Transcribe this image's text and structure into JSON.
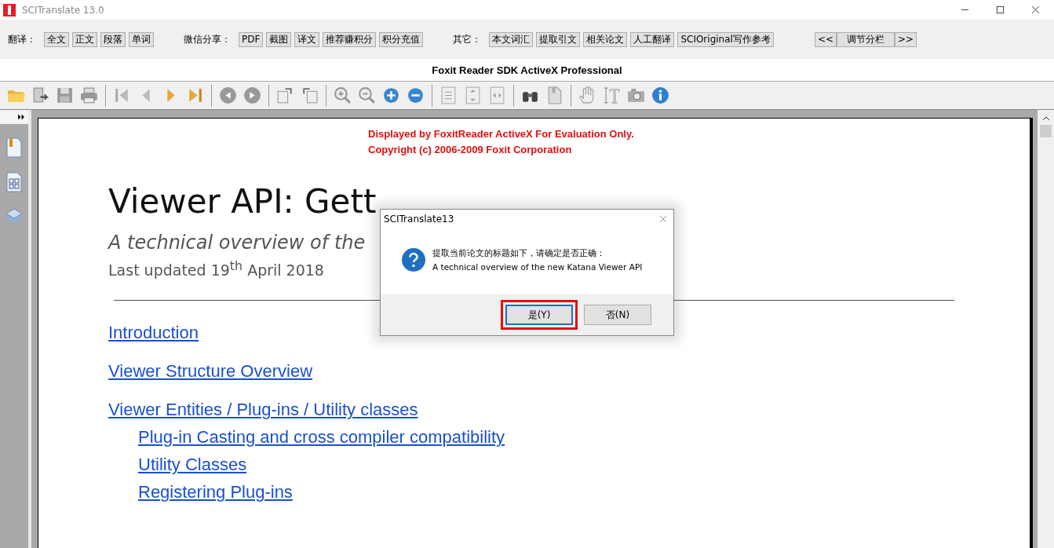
{
  "window": {
    "title": "SCITranslate 13.0"
  },
  "toolbar": {
    "groups": [
      {
        "label": "翻译：",
        "buttons": [
          "全文",
          "正文",
          "段落",
          "单词"
        ]
      },
      {
        "label": "微信分享：",
        "buttons": [
          "PDF",
          "截图",
          "译文",
          "推荐赚积分",
          "积分充值"
        ]
      },
      {
        "label": "其它：",
        "buttons": [
          "本文词汇",
          "提取引文",
          "相关论文",
          "人工翻译",
          "SCIOriginal写作参考"
        ]
      }
    ],
    "nav": {
      "prev": "<<",
      "label": "调节分栏",
      "next": ">>"
    }
  },
  "viewer_title": "Foxit Reader SDK ActiveX Professional",
  "document": {
    "notice": [
      "Displayed by FoxitReader ActiveX For Evaluation Only.",
      "Copyright (c) 2006-2009 Foxit Corporation"
    ],
    "title": "Viewer API: Gett",
    "subtitle": "A technical overview of the",
    "updated": "Last updated 19$^{th}$ April 2018",
    "toc": [
      {
        "text": "Introduction"
      },
      {
        "text": "Viewer Structure Overview"
      },
      {
        "text": "Viewer Entities / Plug-ins / Utility classes",
        "children": [
          {
            "text": "Plug-in Casting and cross compiler compatibility"
          },
          {
            "text": "Utility Classes"
          },
          {
            "text": "Registering Plug-ins"
          }
        ]
      }
    ]
  },
  "dialog": {
    "title": "SCITranslate13",
    "message": "提取当前论文的标题如下，请确定是否正确：",
    "detail": "A technical overview of the new Katana Viewer API",
    "buttons": [
      {
        "label": "是(Y)",
        "selected": true
      },
      {
        "label": "否(N)",
        "selected": false
      }
    ]
  }
}
